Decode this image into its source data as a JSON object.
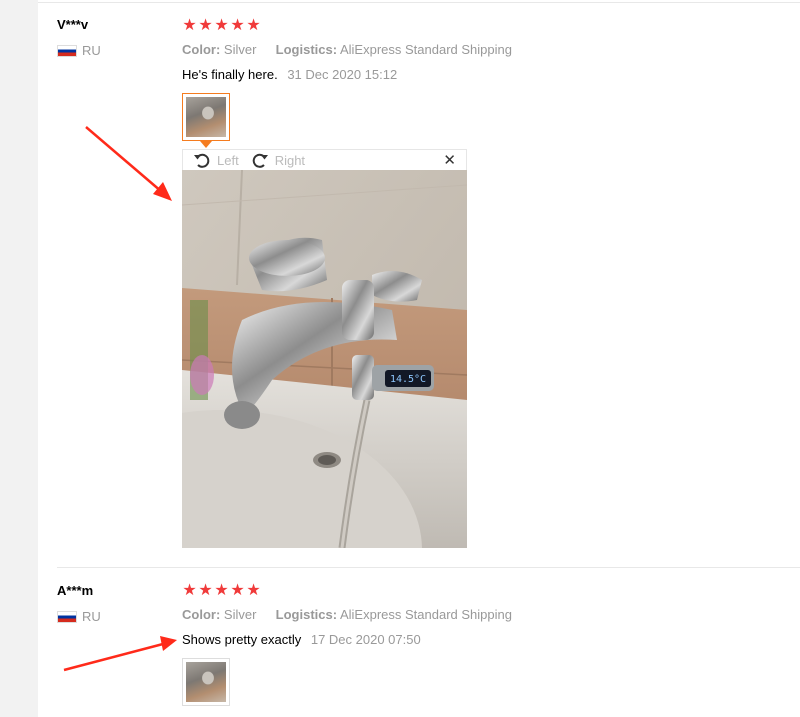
{
  "reviews": [
    {
      "user": "V***v",
      "country": "RU",
      "rating": 5,
      "color_label": "Color:",
      "color_value": "Silver",
      "logistics_label": "Logistics:",
      "logistics_value": "AliExpress Standard Shipping",
      "comment": "He's finally here.",
      "date": "31 Dec 2020 15:12"
    },
    {
      "user": "A***m",
      "country": "RU",
      "rating": 5,
      "color_label": "Color:",
      "color_value": "Silver",
      "logistics_label": "Logistics:",
      "logistics_value": "AliExpress Standard Shipping",
      "comment": "Shows pretty exactly",
      "date": "17 Dec 2020 07:50"
    }
  ],
  "viewer": {
    "rotate_left_label": "Left",
    "rotate_right_label": "Right",
    "close_label": "✕",
    "thermometer_reading": "14.5°C"
  },
  "colors": {
    "star": "#f03a3a",
    "active_thumb_border": "#f57c1f",
    "annotation_arrow": "#ff2a1a"
  },
  "icons": {
    "star": "★",
    "rotate_left": "rotate-left-icon",
    "rotate_right": "rotate-right-icon"
  }
}
